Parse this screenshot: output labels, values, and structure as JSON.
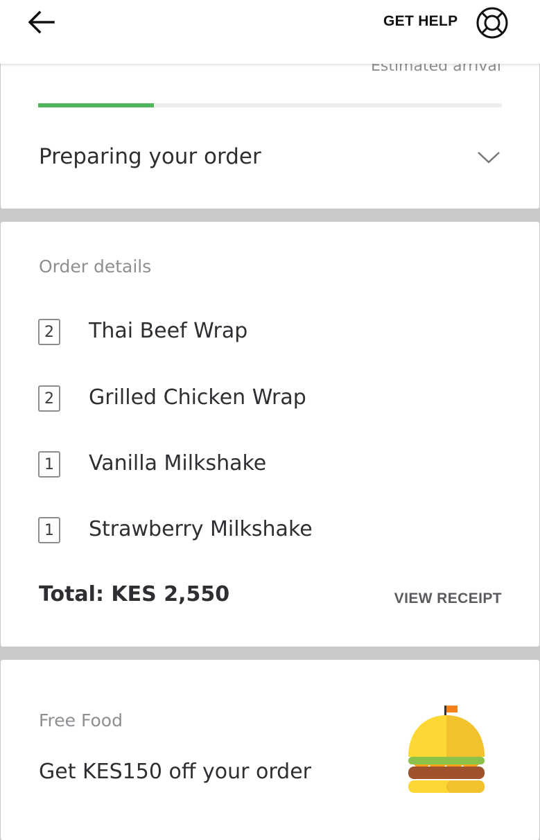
{
  "header": {
    "help_label": "GET HELP"
  },
  "status_card": {
    "eta_label": "Estimated arrival",
    "progress": 0.25,
    "progress_color": "#4fb85f",
    "status": "Preparing your order"
  },
  "order": {
    "title": "Order details",
    "items": [
      {
        "qty": "2",
        "name": "Thai Beef Wrap"
      },
      {
        "qty": "2",
        "name": "Grilled Chicken Wrap"
      },
      {
        "qty": "1",
        "name": "Vanilla Milkshake"
      },
      {
        "qty": "1",
        "name": "Strawberry Milkshake"
      }
    ],
    "total": "Total: KES 2,550",
    "receipt_label": "VIEW RECEIPT"
  },
  "promo": {
    "label": "Free Food",
    "text": "Get KES150 off your order"
  },
  "icons": {
    "back": "arrow-left-icon",
    "help": "lifebuoy-icon",
    "expand": "chevron-down-icon",
    "promo": "burger-icon"
  }
}
